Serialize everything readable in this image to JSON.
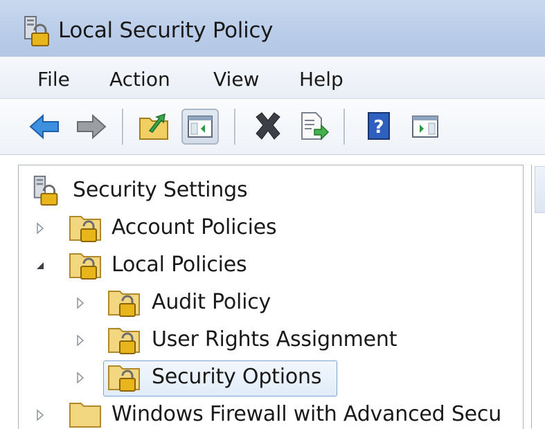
{
  "window": {
    "title": "Local Security Policy",
    "icon": "security-policy-icon"
  },
  "menu": {
    "items": [
      "File",
      "Action",
      "View",
      "Help"
    ]
  },
  "toolbar": {
    "buttons": [
      {
        "name": "back",
        "icon": "back-arrow-icon"
      },
      {
        "name": "forward",
        "icon": "forward-arrow-icon"
      },
      {
        "name": "up-one-level",
        "icon": "up-folder-icon"
      },
      {
        "name": "show-hide-console-tree",
        "icon": "console-tree-icon",
        "pressed": true
      },
      {
        "name": "delete",
        "icon": "delete-icon"
      },
      {
        "name": "export-list",
        "icon": "export-list-icon"
      },
      {
        "name": "help",
        "icon": "help-icon",
        "glyph": "?"
      },
      {
        "name": "show-hide-action-pane",
        "icon": "action-pane-icon"
      }
    ]
  },
  "tree": {
    "root": "Security Settings",
    "nodes": [
      {
        "label": "Account Policies",
        "expander": "collapsed"
      },
      {
        "label": "Local Policies",
        "expander": "expanded"
      },
      {
        "label": "Audit Policy",
        "expander": "collapsed"
      },
      {
        "label": "User Rights Assignment",
        "expander": "collapsed"
      },
      {
        "label": "Security Options",
        "expander": "collapsed",
        "selected": true
      },
      {
        "label": "Windows Firewall with Advanced Secu",
        "expander": "collapsed"
      }
    ]
  }
}
